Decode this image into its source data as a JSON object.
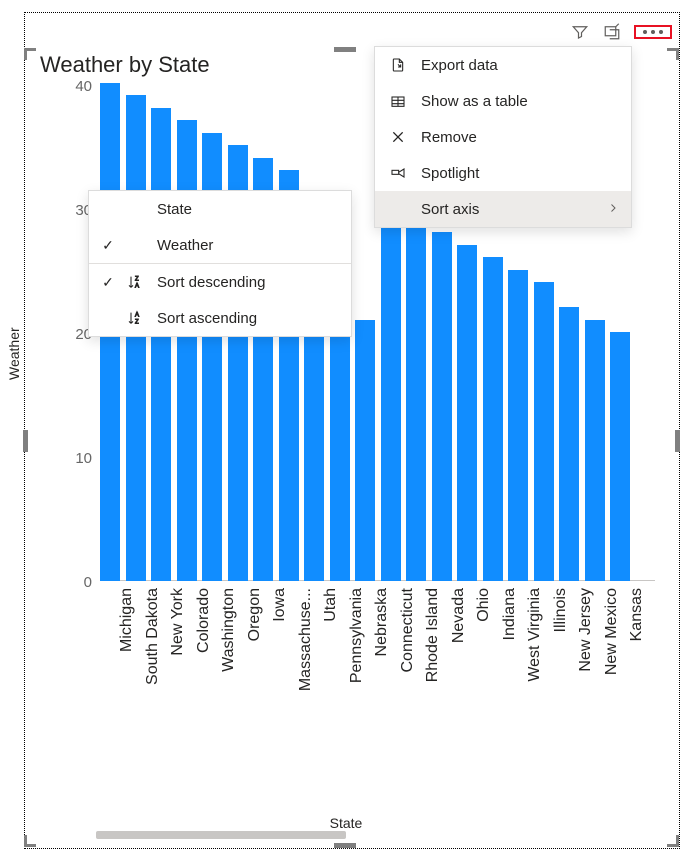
{
  "toolbar": {
    "filter_icon": "filter",
    "focus_icon": "focus-mode",
    "more_icon": "more-options"
  },
  "chart_title": "Weather by State",
  "ylabel": "Weather",
  "xlabel": "State",
  "yticks": [
    "0",
    "10",
    "20",
    "30",
    "40"
  ],
  "menu": {
    "export_data": "Export data",
    "show_as_table": "Show as a table",
    "remove": "Remove",
    "spotlight": "Spotlight",
    "sort_axis": "Sort axis"
  },
  "submenu": {
    "state": "State",
    "weather": "Weather",
    "sort_desc": "Sort descending",
    "sort_asc": "Sort ascending"
  },
  "chart_data": {
    "type": "bar",
    "title": "Weather by State",
    "xlabel": "State",
    "ylabel": "Weather",
    "ylim": [
      0,
      40
    ],
    "categories": [
      "Michigan",
      "South Dakota",
      "New York",
      "Colorado",
      "Washington",
      "Oregon",
      "Iowa",
      "Massachuse...",
      "Utah",
      "Pennsylvania",
      "Nebraska",
      "Connecticut",
      "Rhode Island",
      "Nevada",
      "Ohio",
      "Indiana",
      "West Virginia",
      "Illinois",
      "New Jersey",
      "New Mexico",
      "Kansas"
    ],
    "values": [
      40,
      39,
      38,
      37,
      36,
      35,
      34,
      33,
      21,
      21,
      21,
      29.5,
      29,
      28,
      27,
      26,
      25,
      24,
      23,
      22,
      21,
      20
    ]
  }
}
